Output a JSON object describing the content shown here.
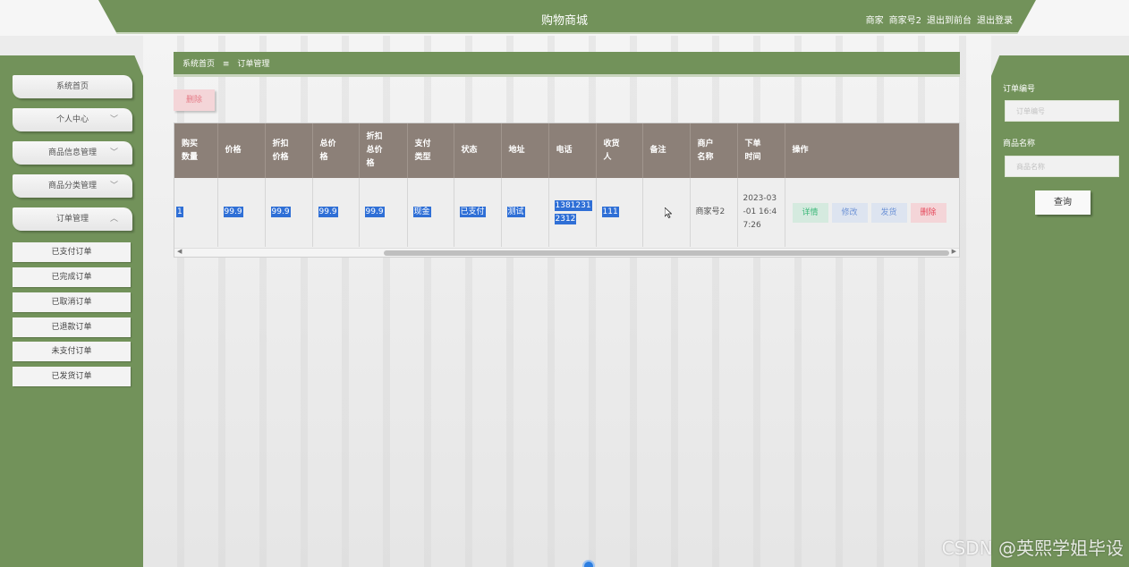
{
  "header": {
    "title": "购物商城",
    "role": "商家",
    "username": "商家号2",
    "to_front": "退出到前台",
    "logout": "退出登录"
  },
  "sidebar": {
    "items": [
      {
        "label": "系统首页",
        "chevron": ""
      },
      {
        "label": "个人中心",
        "chevron": "﹀"
      },
      {
        "label": "商品信息管理",
        "chevron": "﹀"
      },
      {
        "label": "商品分类管理",
        "chevron": "﹀"
      },
      {
        "label": "订单管理",
        "chevron": "︿"
      }
    ],
    "subitems": [
      "已支付订单",
      "已完成订单",
      "已取消订单",
      "已退款订单",
      "未支付订单",
      "已发货订单"
    ]
  },
  "breadcrumb": {
    "home": "系统首页",
    "separator": "≡",
    "current": "订单管理"
  },
  "toolbar": {
    "delete_label": "删除"
  },
  "table": {
    "headers": [
      [
        "购买",
        "数量"
      ],
      [
        "价格"
      ],
      [
        "折扣",
        "价格"
      ],
      [
        "总价",
        "格"
      ],
      [
        "折扣",
        "总价",
        "格"
      ],
      [
        "支付",
        "类型"
      ],
      [
        "状态"
      ],
      [
        "地址"
      ],
      [
        "电话"
      ],
      [
        "收货",
        "人"
      ],
      [
        "备注"
      ],
      [
        "商户",
        "名称"
      ],
      [
        "下单",
        "时间"
      ],
      [
        "操作"
      ]
    ],
    "row": {
      "quantity": "1",
      "price": "99.9",
      "discount_price": "99.9",
      "total": "99.9",
      "discount_total": "99.9",
      "pay_type": "现金",
      "status": "已支付",
      "address": "测试",
      "phone_1": "1381231",
      "phone_2": "2312",
      "receiver": "111",
      "remark": "",
      "merchant": "商家号2",
      "time_1": "2023-03",
      "time_2": "-01 16:4",
      "time_3": "7:26"
    },
    "actions": {
      "detail": "详情",
      "edit": "修改",
      "ship": "发货",
      "delete": "删除"
    }
  },
  "search": {
    "order_no_label": "订单编号",
    "order_no_placeholder": "订单编号",
    "product_name_label": "商品名称",
    "product_name_placeholder": "商品名称",
    "query_label": "查询"
  },
  "watermark": "CSDN @英熙学姐毕设",
  "colors": {
    "accent": "#72925a",
    "table_header": "#8c8078",
    "selection": "#2f6fd6"
  }
}
